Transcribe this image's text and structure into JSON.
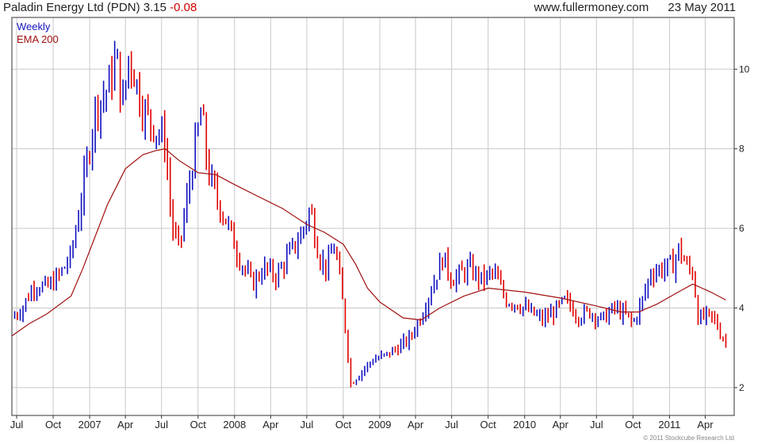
{
  "header": {
    "instrument": "Paladin Energy Ltd (PDN)",
    "price": "3.15",
    "change": "-0.08",
    "site": "www.fullermoney.com",
    "date": "23 May 2011"
  },
  "footer": {
    "copyright": "© 2011 Stockcube Research Ltd"
  },
  "colors": {
    "up": "#1010c0",
    "down": "#e00000",
    "ema": "#a01010",
    "grid": "#c8c8c8",
    "frame": "#333333"
  },
  "chart_data": {
    "type": "candlestick",
    "legend": [
      {
        "label": "Weekly",
        "color": "#1010c0"
      },
      {
        "label": "EMA 200",
        "color": "#a01010"
      }
    ],
    "legend_position": "top-left",
    "grid": true,
    "ylim": [
      1.3,
      11.3
    ],
    "yticks": [
      2,
      4,
      6,
      8,
      10
    ],
    "y_axis_side": "right",
    "xlim": [
      "2006-06-19",
      "2011-06-13"
    ],
    "xticks": [
      {
        "label": "Jul",
        "date": "2006-07-01"
      },
      {
        "label": "Oct",
        "date": "2006-10-01"
      },
      {
        "label": "2007",
        "date": "2007-01-01"
      },
      {
        "label": "Apr",
        "date": "2007-04-01"
      },
      {
        "label": "Jul",
        "date": "2007-07-01"
      },
      {
        "label": "Oct",
        "date": "2007-10-01"
      },
      {
        "label": "2008",
        "date": "2008-01-01"
      },
      {
        "label": "Apr",
        "date": "2008-04-01"
      },
      {
        "label": "Jul",
        "date": "2008-07-01"
      },
      {
        "label": "Oct",
        "date": "2008-10-01"
      },
      {
        "label": "2009",
        "date": "2009-01-01"
      },
      {
        "label": "Apr",
        "date": "2009-04-01"
      },
      {
        "label": "Jul",
        "date": "2009-07-01"
      },
      {
        "label": "Oct",
        "date": "2009-10-01"
      },
      {
        "label": "2010",
        "date": "2010-01-01"
      },
      {
        "label": "Apr",
        "date": "2010-04-01"
      },
      {
        "label": "Jul",
        "date": "2010-07-01"
      },
      {
        "label": "Oct",
        "date": "2010-10-01"
      },
      {
        "label": "2011",
        "date": "2011-01-01"
      },
      {
        "label": "Apr",
        "date": "2011-04-01"
      }
    ],
    "weekly_close_path": [
      [
        "2006-06-19",
        3.75
      ],
      [
        "2006-07-15",
        4.0
      ],
      [
        "2006-08-15",
        4.6
      ],
      [
        "2006-09-15",
        4.5
      ],
      [
        "2006-10-15",
        4.8
      ],
      [
        "2006-11-15",
        5.3
      ],
      [
        "2006-12-15",
        7.0
      ],
      [
        "2007-01-15",
        9.0
      ],
      [
        "2007-02-15",
        9.5
      ],
      [
        "2007-03-10",
        10.3
      ],
      [
        "2007-03-25",
        9.0
      ],
      [
        "2007-04-10",
        10.4
      ],
      [
        "2007-05-15",
        9.0
      ],
      [
        "2007-06-15",
        8.5
      ],
      [
        "2007-07-10",
        8.2
      ],
      [
        "2007-07-28",
        6.0
      ],
      [
        "2007-08-15",
        5.5
      ],
      [
        "2007-09-15",
        7.5
      ],
      [
        "2007-10-10",
        9.0
      ],
      [
        "2007-10-25",
        7.5
      ],
      [
        "2007-11-15",
        6.8
      ],
      [
        "2007-12-15",
        6.1
      ],
      [
        "2008-01-15",
        5.2
      ],
      [
        "2008-02-15",
        4.6
      ],
      [
        "2008-03-15",
        5.0
      ],
      [
        "2008-04-15",
        4.8
      ],
      [
        "2008-05-15",
        5.3
      ],
      [
        "2008-06-15",
        5.8
      ],
      [
        "2008-07-10",
        6.5
      ],
      [
        "2008-08-01",
        5.3
      ],
      [
        "2008-08-20",
        5.0
      ],
      [
        "2008-09-10",
        5.6
      ],
      [
        "2008-10-01",
        4.0
      ],
      [
        "2008-10-20",
        2.1
      ],
      [
        "2008-11-15",
        2.4
      ],
      [
        "2008-12-15",
        2.7
      ],
      [
        "2009-01-15",
        2.8
      ],
      [
        "2009-02-15",
        3.0
      ],
      [
        "2009-03-15",
        3.2
      ],
      [
        "2009-04-15",
        3.8
      ],
      [
        "2009-05-15",
        4.6
      ],
      [
        "2009-06-10",
        5.3
      ],
      [
        "2009-07-01",
        4.7
      ],
      [
        "2009-08-15",
        5.0
      ],
      [
        "2009-09-15",
        4.7
      ],
      [
        "2009-10-15",
        4.9
      ],
      [
        "2009-11-15",
        4.2
      ],
      [
        "2009-12-15",
        4.1
      ],
      [
        "2010-01-15",
        3.9
      ],
      [
        "2010-02-15",
        3.7
      ],
      [
        "2010-03-15",
        3.9
      ],
      [
        "2010-04-15",
        4.2
      ],
      [
        "2010-05-15",
        3.8
      ],
      [
        "2010-06-15",
        3.9
      ],
      [
        "2010-07-15",
        3.7
      ],
      [
        "2010-08-15",
        4.0
      ],
      [
        "2010-09-15",
        3.8
      ],
      [
        "2010-10-01",
        3.6
      ],
      [
        "2010-10-25",
        4.2
      ],
      [
        "2010-11-15",
        4.9
      ],
      [
        "2010-12-15",
        5.0
      ],
      [
        "2011-01-10",
        5.1
      ],
      [
        "2011-01-25",
        5.5
      ],
      [
        "2011-02-15",
        5.0
      ],
      [
        "2011-03-01",
        4.9
      ],
      [
        "2011-03-15",
        3.7
      ],
      [
        "2011-04-05",
        3.8
      ],
      [
        "2011-04-25",
        3.7
      ],
      [
        "2011-05-10",
        3.35
      ],
      [
        "2011-05-23",
        3.15
      ]
    ],
    "ema_200": [
      [
        "2006-06-19",
        3.3
      ],
      [
        "2006-08-01",
        3.6
      ],
      [
        "2006-09-15",
        3.85
      ],
      [
        "2006-11-15",
        4.3
      ],
      [
        "2006-12-15",
        5.0
      ],
      [
        "2007-01-15",
        5.8
      ],
      [
        "2007-02-15",
        6.6
      ],
      [
        "2007-04-01",
        7.5
      ],
      [
        "2007-05-15",
        7.85
      ],
      [
        "2007-06-15",
        7.95
      ],
      [
        "2007-07-10",
        8.0
      ],
      [
        "2007-08-15",
        7.7
      ],
      [
        "2007-10-01",
        7.4
      ],
      [
        "2007-11-15",
        7.35
      ],
      [
        "2008-01-01",
        7.1
      ],
      [
        "2008-03-01",
        6.8
      ],
      [
        "2008-05-01",
        6.5
      ],
      [
        "2008-07-01",
        6.1
      ],
      [
        "2008-08-15",
        5.9
      ],
      [
        "2008-10-01",
        5.6
      ],
      [
        "2008-11-01",
        5.1
      ],
      [
        "2008-12-01",
        4.5
      ],
      [
        "2009-01-01",
        4.15
      ],
      [
        "2009-03-01",
        3.75
      ],
      [
        "2009-04-15",
        3.7
      ],
      [
        "2009-06-01",
        4.0
      ],
      [
        "2009-08-01",
        4.3
      ],
      [
        "2009-10-01",
        4.5
      ],
      [
        "2010-01-01",
        4.4
      ],
      [
        "2010-04-01",
        4.25
      ],
      [
        "2010-07-01",
        4.05
      ],
      [
        "2010-09-01",
        3.9
      ],
      [
        "2010-10-15",
        3.9
      ],
      [
        "2010-12-01",
        4.1
      ],
      [
        "2011-02-01",
        4.45
      ],
      [
        "2011-03-01",
        4.6
      ],
      [
        "2011-04-15",
        4.4
      ],
      [
        "2011-05-23",
        4.2
      ]
    ]
  }
}
